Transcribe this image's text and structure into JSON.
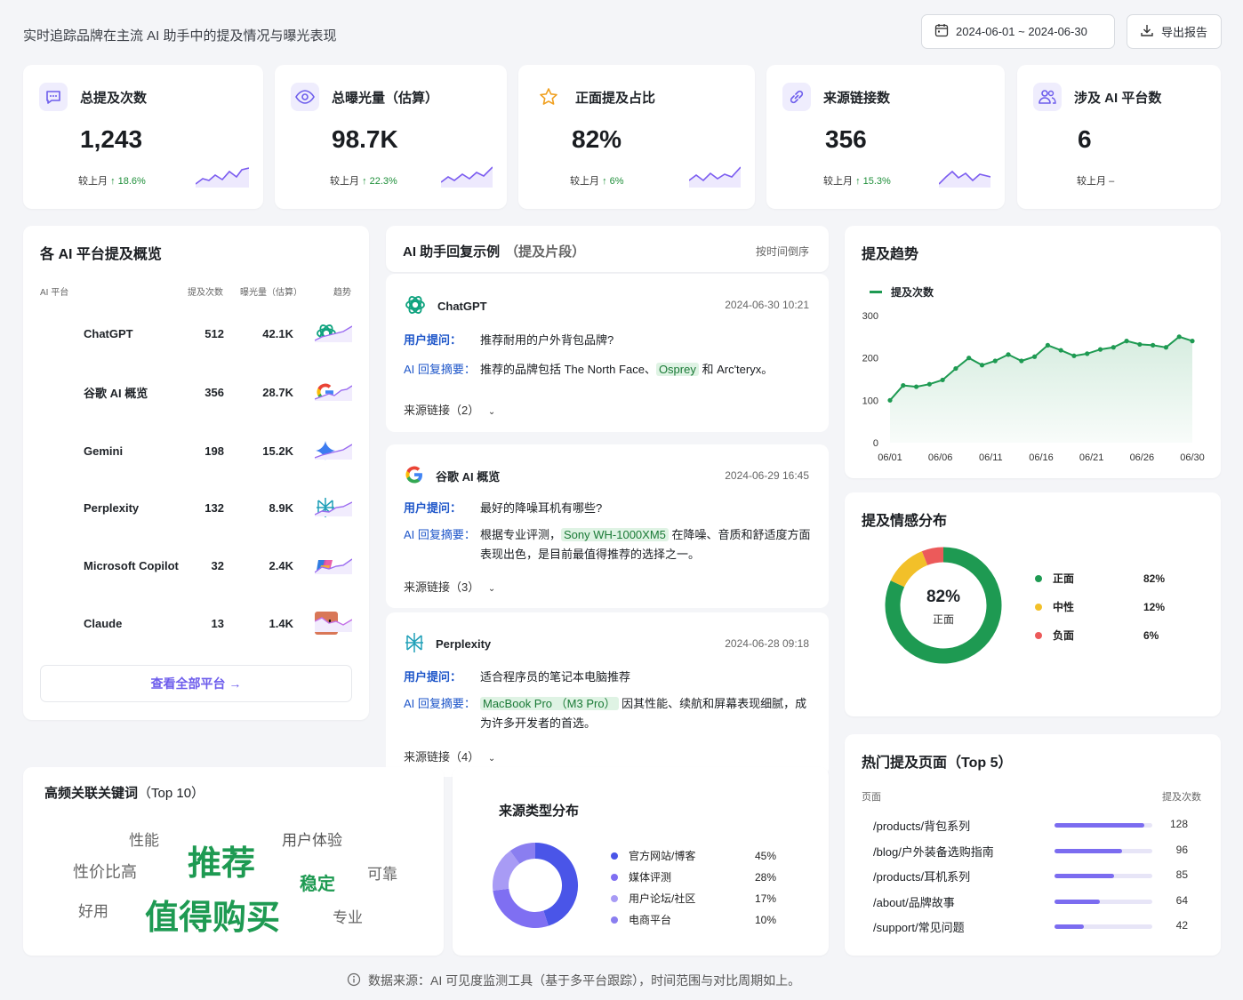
{
  "header": {
    "subtitle": "实时追踪品牌在主流 AI 助手中的提及情况与曝光表现",
    "date_range": "2024-06-01 ~ 2024-06-30",
    "export_label": "导出报告"
  },
  "kpis": [
    {
      "label": "总提及次数",
      "value": "1,243",
      "cmp_label": "较上月",
      "change": "↑ 18.6%",
      "icon": "chat-icon"
    },
    {
      "label": "总曝光量（估算）",
      "value": "98.7K",
      "cmp_label": "较上月",
      "change": "↑ 22.3%",
      "icon": "eye-icon"
    },
    {
      "label": "正面提及占比",
      "value": "82%",
      "cmp_label": "较上月",
      "change": "↑ 6%",
      "icon": "star-icon"
    },
    {
      "label": "来源链接数",
      "value": "356",
      "cmp_label": "较上月",
      "change": "↑ 15.3%",
      "icon": "link-icon"
    },
    {
      "label": "涉及 AI 平台数",
      "value": "6",
      "cmp_label": "较上月",
      "change": "–",
      "icon": "users-icon"
    }
  ],
  "platforms": {
    "title": "各 AI 平台提及概览",
    "col_platform": "AI 平台",
    "col_mentions": "提及次数",
    "col_exposure": "曝光量（估算）",
    "col_trend": "趋势",
    "rows": [
      {
        "name": "ChatGPT",
        "mentions": "512",
        "exposure": "42.1K",
        "icon": "chatgpt-icon"
      },
      {
        "name": "谷歌 AI 概览",
        "mentions": "356",
        "exposure": "28.7K",
        "icon": "google-icon"
      },
      {
        "name": "Gemini",
        "mentions": "198",
        "exposure": "15.2K",
        "icon": "gemini-icon"
      },
      {
        "name": "Perplexity",
        "mentions": "132",
        "exposure": "8.9K",
        "icon": "perplexity-icon"
      },
      {
        "name": "Microsoft Copilot",
        "mentions": "32",
        "exposure": "2.4K",
        "icon": "copilot-icon"
      },
      {
        "name": "Claude",
        "mentions": "13",
        "exposure": "1.4K",
        "icon": "claude-icon"
      }
    ],
    "view_all": "查看全部平台 →"
  },
  "responses": {
    "title": "AI 助手回复示例",
    "title_suffix": "（提及片段）",
    "sort_label": "按时间倒序",
    "q_label": "用户提问：",
    "a_label": "AI 回复摘要：",
    "items": [
      {
        "platform": "ChatGPT",
        "time": "2024-06-30 10:21",
        "question": "推荐耐用的户外背包品牌?",
        "a_pre": "推荐的品牌包括 The North Face、",
        "a_hl": "Osprey",
        "a_post": " 和 Arc'teryx。",
        "sources": "来源链接（2）"
      },
      {
        "platform": "谷歌 AI 概览",
        "time": "2024-06-29 16:45",
        "question": "最好的降噪耳机有哪些?",
        "a_pre": "根据专业评测，",
        "a_hl": "Sony WH-1000XM5",
        "a_post": " 在降噪、音质和舒适度方面表现出色，是目前最值得推荐的选择之一。",
        "sources": "来源链接（3）"
      },
      {
        "platform": "Perplexity",
        "time": "2024-06-28 09:18",
        "question": "适合程序员的笔记本电脑推荐",
        "a_pre": "",
        "a_hl": "MacBook Pro （M3 Pro）",
        "a_post": " 因其性能、续航和屏幕表现细腻，成为许多开发者的首选。",
        "sources": "来源链接（4）"
      }
    ]
  },
  "trend": {
    "title": "提及趋势",
    "legend": "提及次数"
  },
  "chart_data": [
    {
      "type": "area",
      "title": "提及趋势",
      "series": [
        {
          "name": "提及次数",
          "values": [
            100,
            135,
            132,
            138,
            148,
            175,
            200,
            183,
            193,
            208,
            193,
            203,
            230,
            218,
            205,
            210,
            220,
            225,
            240,
            232,
            230,
            225,
            250,
            240
          ]
        }
      ],
      "x": [
        "06/01",
        "06/03",
        "06/04",
        "06/06",
        "06/07",
        "06/09",
        "06/11",
        "06/12",
        "06/13",
        "06/14",
        "06/15",
        "06/16",
        "06/17",
        "06/18",
        "06/19",
        "06/21",
        "06/23",
        "06/24",
        "06/26",
        "06/27",
        "06/28",
        "06/29",
        "06/29b",
        "06/30"
      ],
      "x_ticks": [
        "06/01",
        "06/06",
        "06/11",
        "06/16",
        "06/21",
        "06/26",
        "06/30"
      ],
      "y_ticks": [
        0,
        100,
        200,
        300
      ],
      "ylim": [
        0,
        300
      ],
      "color": "#1e9a52"
    },
    {
      "type": "pie",
      "title": "提及情感分布",
      "center_value": "82%",
      "center_label": "正面",
      "slices": [
        {
          "label": "正面",
          "value": 82,
          "text": "82%",
          "color": "#1e9a52"
        },
        {
          "label": "中性",
          "value": 12,
          "text": "12%",
          "color": "#f2c029"
        },
        {
          "label": "负面",
          "value": 6,
          "text": "6%",
          "color": "#ec5a5a"
        }
      ]
    },
    {
      "type": "pie",
      "title": "来源类型分布",
      "slices": [
        {
          "label": "官方网站/博客",
          "value": 45,
          "text": "45%",
          "color": "#4a55e8"
        },
        {
          "label": "媒体评测",
          "value": 28,
          "text": "28%",
          "color": "#7f6ff2"
        },
        {
          "label": "用户论坛/社区",
          "value": 17,
          "text": "17%",
          "color": "#a89bf5"
        },
        {
          "label": "电商平台",
          "value": 10,
          "text": "10%",
          "color": "#8a7ef0"
        }
      ]
    }
  ],
  "keywords": {
    "title": "高频关联关键词",
    "title_suffix": "（Top 10）",
    "words": [
      "性能",
      "推荐",
      "用户体验",
      "性价比高",
      "稳定",
      "可靠",
      "好用",
      "值得购买",
      "专业"
    ]
  },
  "sentiment": {
    "title": "提及情感分布"
  },
  "sources_dist": {
    "title": "来源类型分布"
  },
  "top_pages": {
    "title": "热门提及页面（Top 5）",
    "col_page": "页面",
    "col_count": "提及次数",
    "rows": [
      {
        "page": "/products/背包系列",
        "count": 128,
        "text": "128"
      },
      {
        "page": "/blog/户外装备选购指南",
        "count": 96,
        "text": "96"
      },
      {
        "page": "/products/耳机系列",
        "count": 85,
        "text": "85"
      },
      {
        "page": "/about/品牌故事",
        "count": 64,
        "text": "64"
      },
      {
        "page": "/support/常见问题",
        "count": 42,
        "text": "42"
      }
    ]
  },
  "footer": {
    "note": "数据来源：AI 可见度监测工具（基于多平台跟踪），时间范围与对比周期如上。"
  }
}
